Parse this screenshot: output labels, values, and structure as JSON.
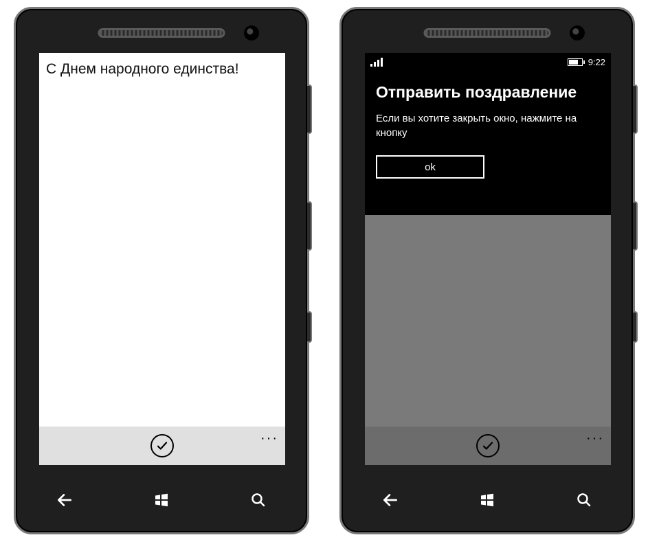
{
  "left_screen": {
    "title": "С Днем народного единства!",
    "appbar": {
      "confirm_icon": "check",
      "more_glyph": "···"
    }
  },
  "right_screen": {
    "status": {
      "time": "9:22"
    },
    "dialog": {
      "title": "Отправить поздравление",
      "message": "Если вы хотите закрыть окно, нажмите на кнопку",
      "ok_label": "ok"
    },
    "appbar": {
      "confirm_icon": "check",
      "more_glyph": "···"
    }
  },
  "nav": {
    "back": "back",
    "start": "windows",
    "search": "search"
  }
}
